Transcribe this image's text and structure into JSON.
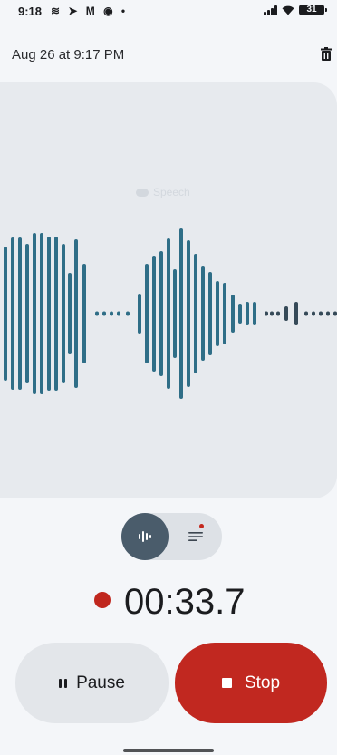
{
  "status_bar": {
    "time": "9:18",
    "left_icons": [
      "voice-wave-icon",
      "telegram-icon",
      "gmail-icon",
      "app-badge-icon",
      "dot-icon"
    ],
    "left_glyphs": "≋ ➤ M ◉ •",
    "right_icons": [
      "signal-icon",
      "wifi-icon",
      "battery-icon"
    ],
    "battery": "31"
  },
  "header": {
    "title": "Aug 26 at 9:17 PM",
    "delete_icon": "trash-icon"
  },
  "recording": {
    "overlay_label": "Speech",
    "waveform_colors": {
      "speech": "#2f6e87",
      "silence": "#364a58",
      "background": "#e7eaee"
    },
    "view_toggle": {
      "selected": "waveform",
      "options": [
        "waveform",
        "transcript"
      ]
    },
    "elapsed": "00:33.7",
    "status_color": "#c0271e"
  },
  "controls": {
    "pause_label": "Pause",
    "stop_label": "Stop",
    "stop_color": "#c12820"
  }
}
